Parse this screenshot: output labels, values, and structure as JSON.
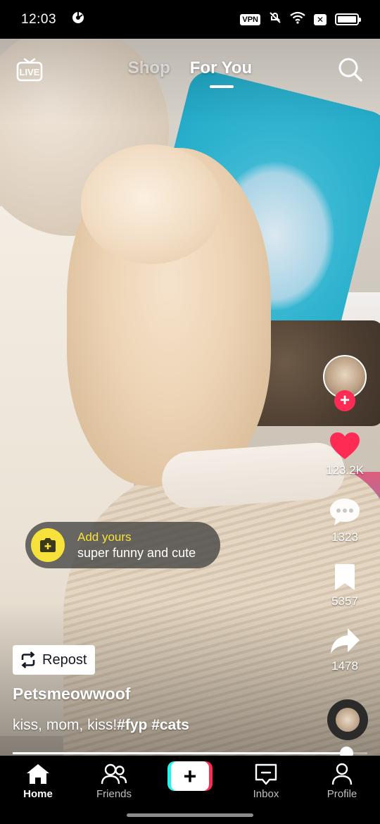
{
  "status_bar": {
    "time": "12:03",
    "vpn": "VPN",
    "icons": [
      "app-status-icon",
      "vpn-icon",
      "mute-icon",
      "wifi-icon",
      "x-badge-icon",
      "battery-icon"
    ]
  },
  "top_nav": {
    "live_label": "LIVE",
    "tabs": [
      {
        "label": "Shop",
        "active": false
      },
      {
        "label": "For You",
        "active": true
      }
    ]
  },
  "rail": {
    "likes": "123.2K",
    "comments": "1323",
    "saves": "5357",
    "shares": "1478"
  },
  "add_yours": {
    "title": "Add yours",
    "subtitle": "super funny and cute"
  },
  "repost": {
    "label": "Repost"
  },
  "post": {
    "username": "Petsmeowwoof",
    "caption_text": "kiss, mom, kiss!",
    "hashtags": [
      "#fyp",
      "#cats"
    ]
  },
  "progress": {
    "fraction": 0.94
  },
  "bottom_nav": {
    "items": [
      {
        "label": "Home",
        "active": true
      },
      {
        "label": "Friends",
        "active": false
      },
      {
        "label": "",
        "active": false
      },
      {
        "label": "Inbox",
        "active": false
      },
      {
        "label": "Profile",
        "active": false
      }
    ]
  },
  "colors": {
    "accent_red": "#fe2c55",
    "accent_cyan": "#25f4ee",
    "add_yours_yellow": "#f7e23c"
  }
}
